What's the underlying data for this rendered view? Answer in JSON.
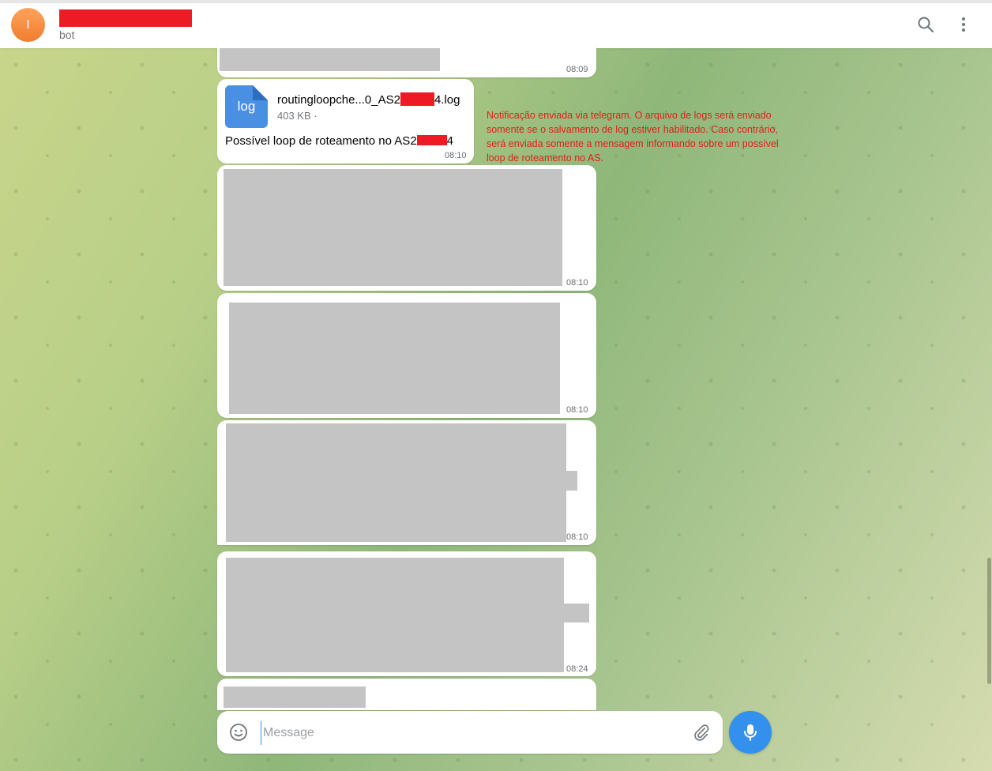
{
  "header": {
    "avatar_letter": "I",
    "subtitle": "bot",
    "accent": "#3390ec"
  },
  "messages": [
    {
      "time": "08:09"
    },
    {
      "file_icon_label": "log",
      "file_name": "routingloopche...0_AS2",
      "file_ext": "4.log",
      "file_size": "403 KB ·",
      "text_prefix": "Possível loop de roteamento no AS2",
      "text_suffix": "4",
      "time": "08:10"
    },
    {
      "time": "08:10"
    },
    {
      "time": "08:10"
    },
    {
      "time": "08:10"
    },
    {
      "time": "08:24"
    }
  ],
  "annotation": "Notificação enviada via telegram. O arquivo de logs será enviado somente se o salvamento de log estiver habilitado. Caso contrário, será enviada somente a mensagem informando sobre um possível loop de roteamento no AS.",
  "composer": {
    "placeholder": "Message"
  },
  "colors": {
    "redaction": "#ed1c24",
    "annotation_text": "#e0201a",
    "file_icon": "#4a90e2"
  }
}
